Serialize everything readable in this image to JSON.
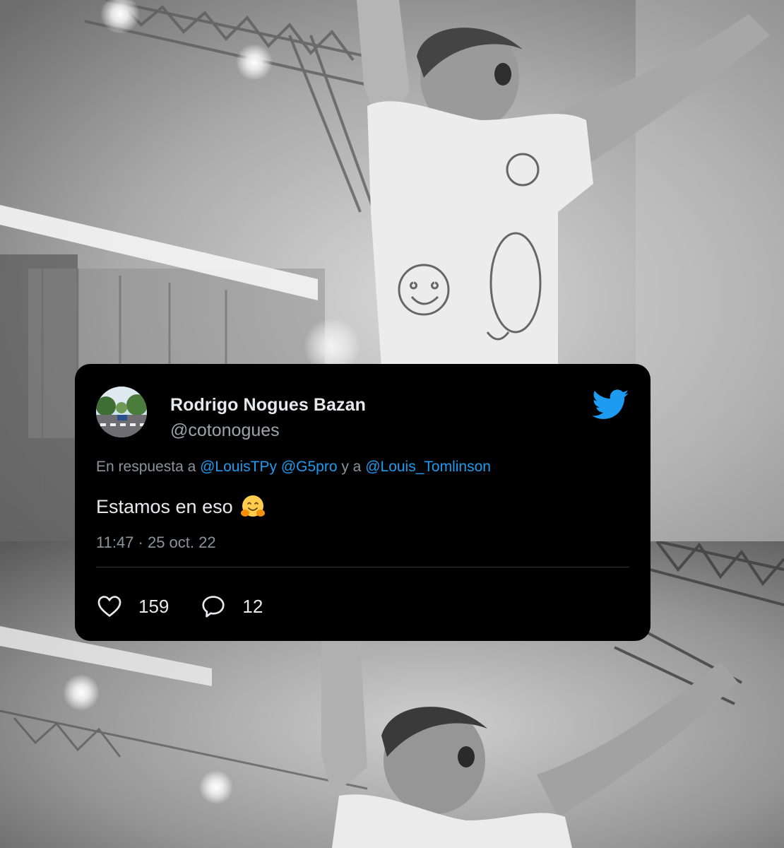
{
  "tweet": {
    "display_name": "Rodrigo Nogues Bazan",
    "handle": "@cotonogues",
    "reply_prefix": "En respuesta a",
    "mentions": [
      "@LouisTPy",
      "@G5pro",
      "@Louis_Tomlinson"
    ],
    "reply_joiner": "y a",
    "text": "Estamos en eso",
    "emoji": "hugging-face",
    "timestamp": "11:47 · 25 oct. 22",
    "likes": "159",
    "replies": "12"
  },
  "icons": {
    "logo": "twitter-bird-icon",
    "like": "heart-icon",
    "reply": "speech-bubble-icon"
  },
  "colors": {
    "card_background": "#000000",
    "accent": "#1d9bf0",
    "secondary_text": "#8b939b"
  }
}
